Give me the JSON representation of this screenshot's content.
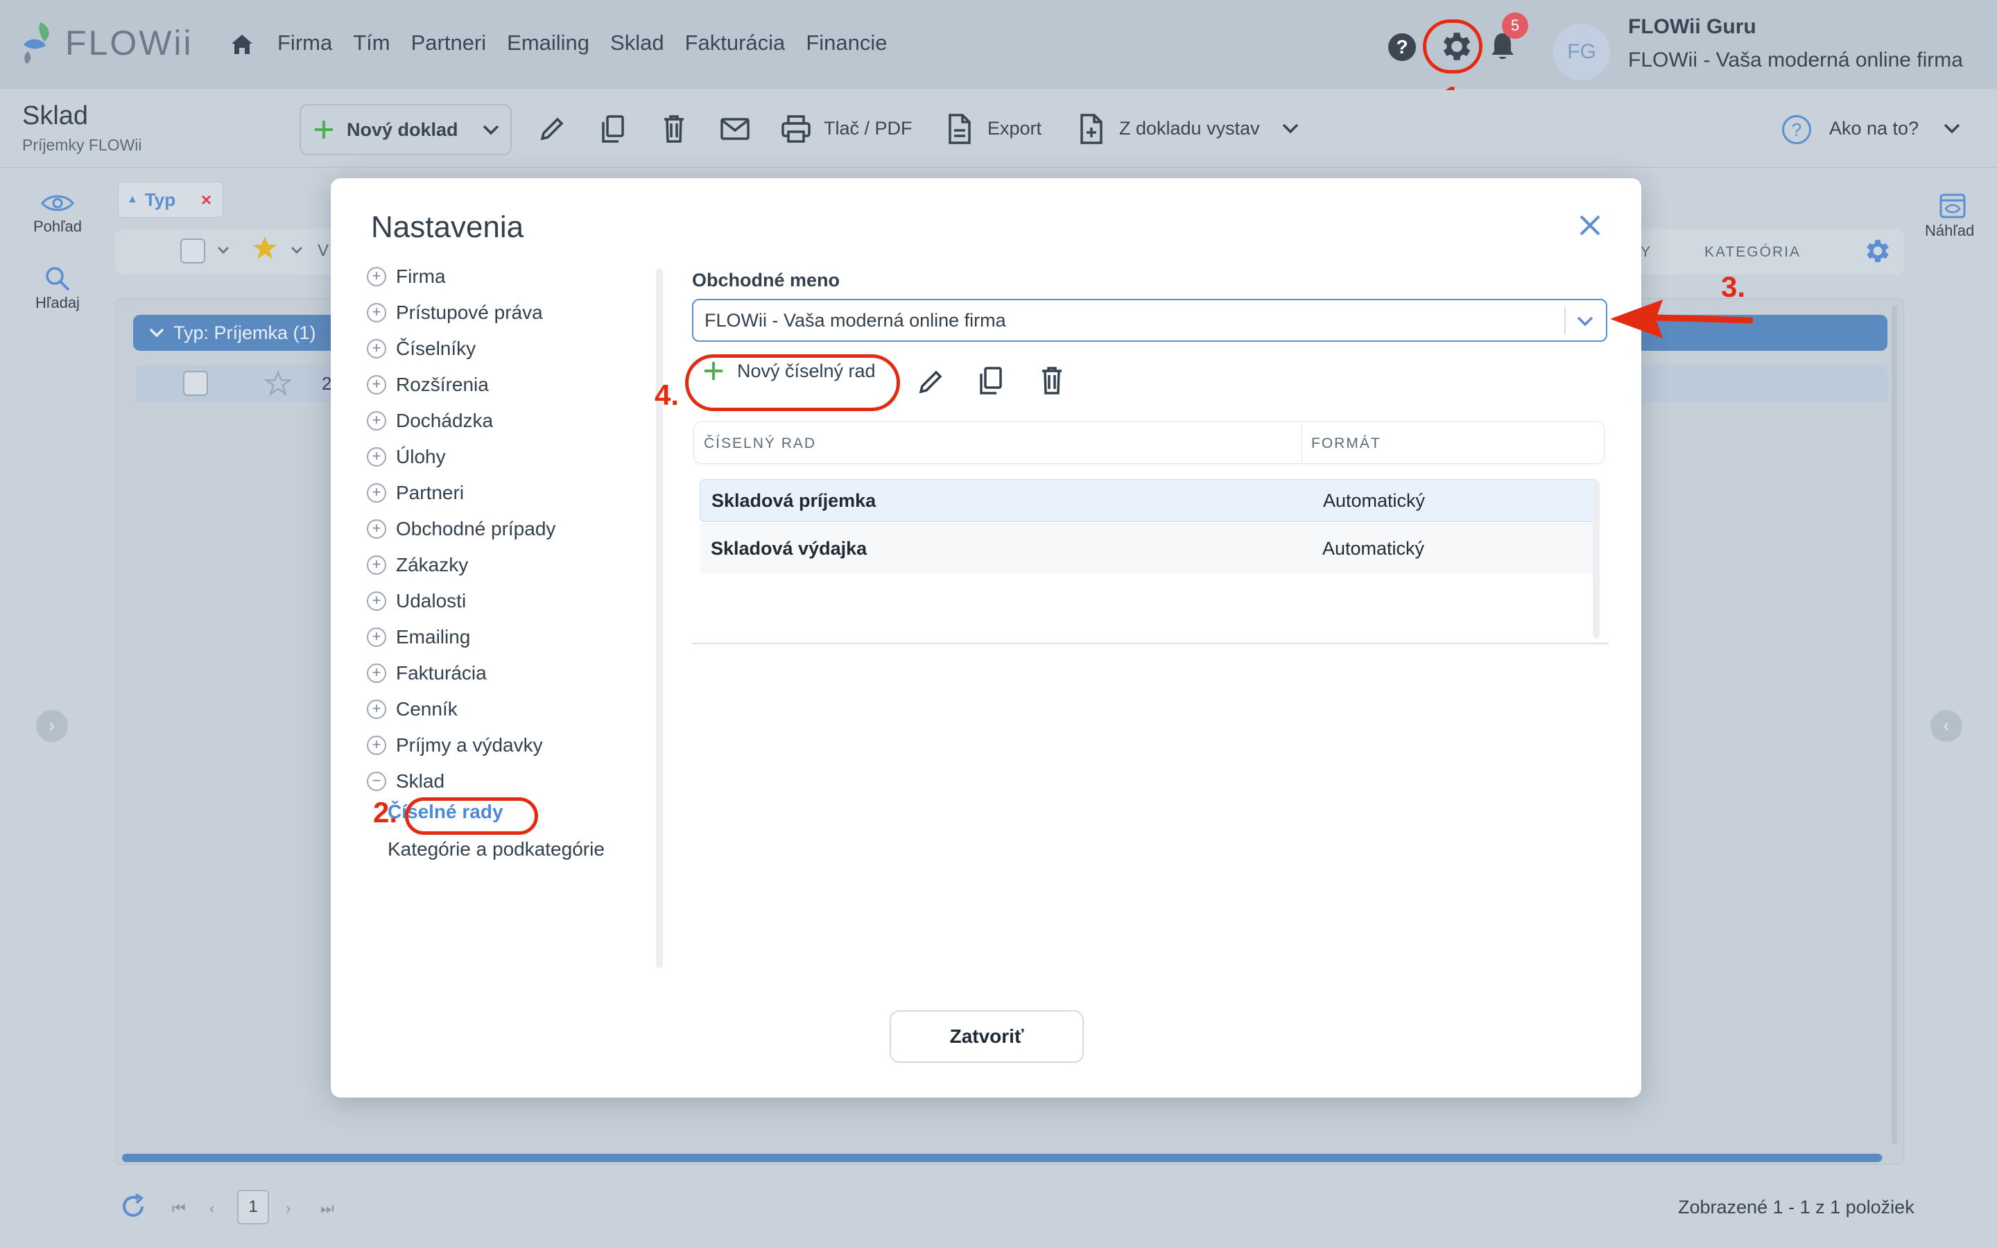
{
  "topnav": {
    "logo_text": "FLOWii",
    "menu": [
      "Firma",
      "Tím",
      "Partneri",
      "Emailing",
      "Sklad",
      "Fakturácia",
      "Financie"
    ],
    "help_label": "?",
    "notification_count": "5",
    "avatar_initials": "FG",
    "user_name": "FLOWii Guru",
    "user_company": "FLOWii - Vaša moderná online firma"
  },
  "toolbar": {
    "module_title": "Sklad",
    "module_subtitle": "Príjemky FLOWii",
    "new_doc_label": "Nový doklad",
    "print_label": "Tlač / PDF",
    "export_label": "Export",
    "from_doc_label": "Z dokladu vystav",
    "help_label": "Ako na to?"
  },
  "rail": {
    "view_label": "Pohľad",
    "search_label": "Hľadaj",
    "preview_label": "Náhľad"
  },
  "list": {
    "filter_chip": "Typ",
    "filter_remove": "×",
    "col_hidden_fragment": "V",
    "col_y_fragment": "Y",
    "col_category": "KATEGÓRIA",
    "group_label": "Typ: Príjemka (1)",
    "row_number": "2"
  },
  "pagination": {
    "current_page": "1",
    "info": "Zobrazené 1 - 1 z 1 položiek"
  },
  "modal": {
    "title": "Nastavenia",
    "sidebar": [
      {
        "label": "Firma",
        "symbol": "+"
      },
      {
        "label": "Prístupové práva",
        "symbol": "+"
      },
      {
        "label": "Číselníky",
        "symbol": "+"
      },
      {
        "label": "Rozšírenia",
        "symbol": "+"
      },
      {
        "label": "Dochádzka",
        "symbol": "+"
      },
      {
        "label": "Úlohy",
        "symbol": "+"
      },
      {
        "label": "Partneri",
        "symbol": "+"
      },
      {
        "label": "Obchodné prípady",
        "symbol": "+"
      },
      {
        "label": "Zákazky",
        "symbol": "+"
      },
      {
        "label": "Udalosti",
        "symbol": "+"
      },
      {
        "label": "Emailing",
        "symbol": "+"
      },
      {
        "label": "Fakturácia",
        "symbol": "+"
      },
      {
        "label": "Cenník",
        "symbol": "+"
      },
      {
        "label": "Príjmy a výdavky",
        "symbol": "+"
      },
      {
        "label": "Sklad",
        "symbol": "−"
      }
    ],
    "sklad_children": [
      "Číselné rady",
      "Kategórie a podkategórie"
    ],
    "field_label": "Obchodné meno",
    "select_value": "FLOWii - Vaša moderná online firma",
    "new_series_label": "Nový číselný rad",
    "table": {
      "headers": [
        "ČÍSELNÝ RAD",
        "FORMÁT"
      ],
      "rows": [
        [
          "Skladová príjemka",
          "Automatický"
        ],
        [
          "Skladová výdajka",
          "Automatický"
        ]
      ]
    },
    "close_button": "Zatvoriť"
  },
  "annotations": [
    "1.",
    "2.",
    "3.",
    "4."
  ],
  "colors": {
    "accent": "#5b8fd0",
    "annotation_red": "#e32b12",
    "add_green": "#4caf50",
    "badge_red": "#e35b63"
  }
}
